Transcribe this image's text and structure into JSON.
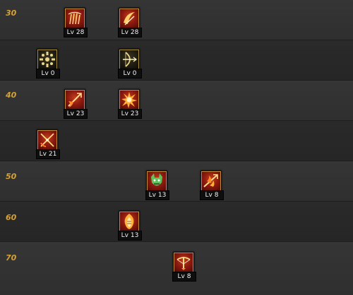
{
  "level_rows": [
    {
      "label": "30"
    },
    {
      "label": ""
    },
    {
      "label": "40"
    },
    {
      "label": ""
    },
    {
      "label": "50"
    },
    {
      "label": "60"
    },
    {
      "label": "70"
    }
  ],
  "skills": [
    {
      "row": 0,
      "col": "a",
      "icon": "claw-strike-icon",
      "style": "red",
      "level": "Lv 28"
    },
    {
      "row": 0,
      "col": "b",
      "icon": "crescent-slash-icon",
      "style": "red",
      "level": "Lv 28"
    },
    {
      "row": 1,
      "col": "c",
      "icon": "radiant-burst-icon",
      "style": "gold",
      "level": "Lv 0"
    },
    {
      "row": 1,
      "col": "b",
      "icon": "bow-draw-icon",
      "style": "gold",
      "level": "Lv 0"
    },
    {
      "row": 2,
      "col": "a",
      "icon": "fire-arrow-icon",
      "style": "red",
      "level": "Lv 23"
    },
    {
      "row": 2,
      "col": "b",
      "icon": "explosion-icon",
      "style": "red",
      "level": "Lv 23"
    },
    {
      "row": 3,
      "col": "c",
      "icon": "cross-blades-icon",
      "style": "red",
      "level": "Lv 21"
    },
    {
      "row": 4,
      "col": "d",
      "icon": "demon-roar-icon",
      "style": "red",
      "level": "Lv 13"
    },
    {
      "row": 4,
      "col": "e",
      "icon": "flame-arrow-icon",
      "style": "red",
      "level": "Lv 8"
    },
    {
      "row": 5,
      "col": "b",
      "icon": "fire-shield-icon",
      "style": "red",
      "level": "Lv 13"
    },
    {
      "row": 6,
      "col": "f",
      "icon": "crossbow-icon",
      "style": "red",
      "level": "Lv 8"
    }
  ],
  "colors": {
    "level_label": "#d6a235",
    "icon_red": "#8e1a0f",
    "icon_gold": "#a88d3b",
    "button_diamond": "#e0a437"
  },
  "top_button_icon": "diamond-icon"
}
